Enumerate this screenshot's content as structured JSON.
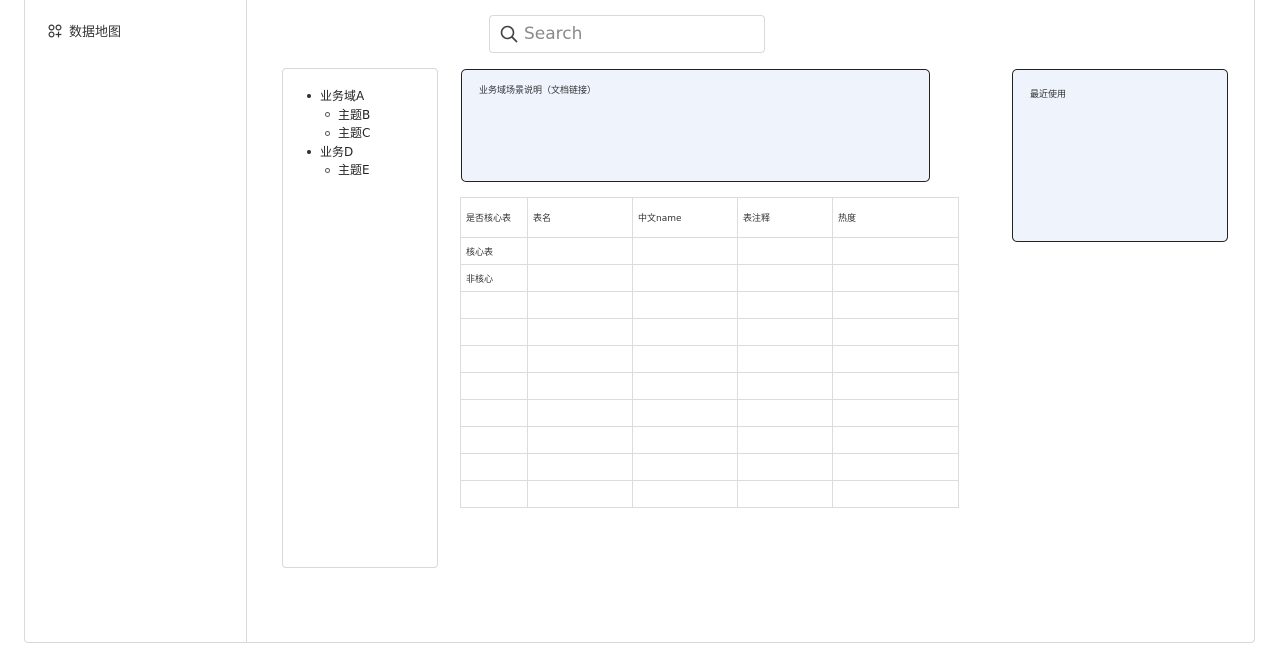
{
  "sidebar": {
    "items": [
      {
        "icon": "grid-icon",
        "label": "数据地图"
      }
    ]
  },
  "search": {
    "placeholder": "Search",
    "value": ""
  },
  "tree": [
    {
      "label": "业务域A",
      "children": [
        "主题B",
        "主题C"
      ]
    },
    {
      "label": "业务D",
      "children": [
        "主题E"
      ]
    }
  ],
  "description": {
    "text": "业务域场景说明（文档链接）"
  },
  "recent": {
    "title": "最近使用"
  },
  "table": {
    "columns": [
      "是否核心表",
      "表名",
      "中文name",
      "表注释",
      "热度"
    ],
    "rows": [
      [
        "核心表",
        "",
        "",
        "",
        ""
      ],
      [
        "非核心",
        "",
        "",
        "",
        ""
      ],
      [
        "",
        "",
        "",
        "",
        ""
      ],
      [
        "",
        "",
        "",
        "",
        ""
      ],
      [
        "",
        "",
        "",
        "",
        ""
      ],
      [
        "",
        "",
        "",
        "",
        ""
      ],
      [
        "",
        "",
        "",
        "",
        ""
      ],
      [
        "",
        "",
        "",
        "",
        ""
      ],
      [
        "",
        "",
        "",
        "",
        ""
      ],
      [
        "",
        "",
        "",
        "",
        ""
      ]
    ]
  },
  "colors": {
    "panel_bg": "#eef3fc",
    "border": "#d9d9d9",
    "panel_border": "#222222"
  }
}
